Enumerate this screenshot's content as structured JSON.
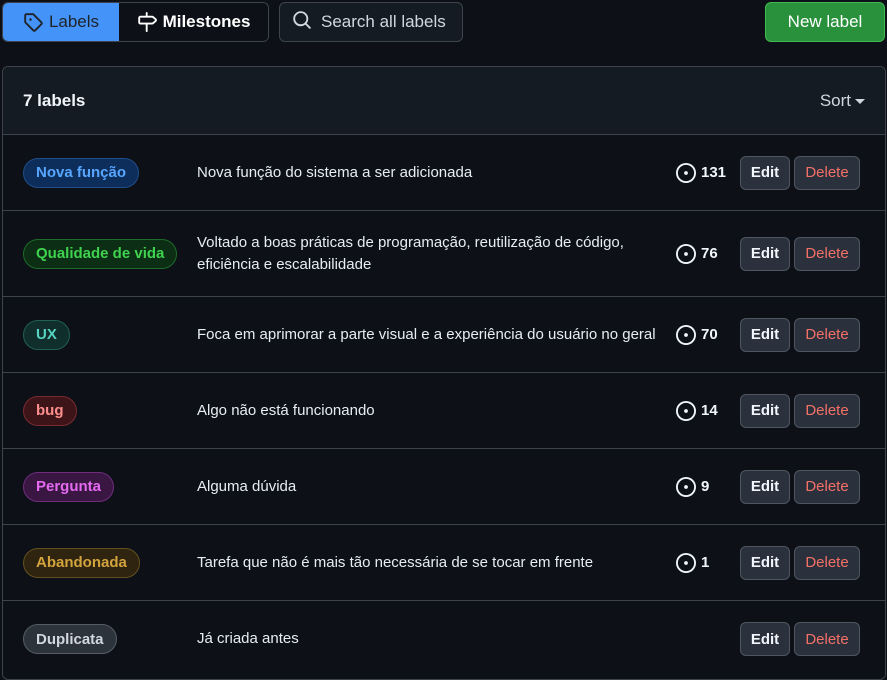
{
  "nav": {
    "labels_tab": "Labels",
    "milestones_tab": "Milestones",
    "search_placeholder": "Search all labels",
    "new_label_button": "New label"
  },
  "list": {
    "title": "7 labels",
    "sort_label": "Sort",
    "edit_label": "Edit",
    "delete_label": "Delete",
    "items": [
      {
        "name": "Nova função",
        "description": "Nova função do sistema a ser adicionada",
        "count": "131",
        "color": "#58a6ff",
        "bg": "#0d2d5a",
        "border": "#1f4e8a"
      },
      {
        "name": "Qualidade de vida",
        "description": "Voltado a boas práticas de programação, reutilização de código, eficiência e escalabilidade",
        "count": "76",
        "color": "#3fd24f",
        "bg": "#0c2e14",
        "border": "#1d6b2a"
      },
      {
        "name": "UX",
        "description": "Foca em aprimorar a parte visual e a experiência do usuário no geral",
        "count": "70",
        "color": "#56d4c0",
        "bg": "#0f2e2c",
        "border": "#215f57"
      },
      {
        "name": "bug",
        "description": "Algo não está funcionando",
        "count": "14",
        "color": "#ff8f8f",
        "bg": "#3d1418",
        "border": "#7a2a31"
      },
      {
        "name": "Pergunta",
        "description": "Alguma dúvida",
        "count": "9",
        "color": "#e46bf0",
        "bg": "#3a1643",
        "border": "#6e2d7d"
      },
      {
        "name": "Abandonada",
        "description": "Tarefa que não é mais tão necessária de se tocar em frente",
        "count": "1",
        "color": "#d3a33d",
        "bg": "#2f2410",
        "border": "#64501f"
      },
      {
        "name": "Duplicata",
        "description": "Já criada antes",
        "count": "",
        "color": "#d1d7e0",
        "bg": "#2d333b",
        "border": "#545d68"
      }
    ]
  }
}
